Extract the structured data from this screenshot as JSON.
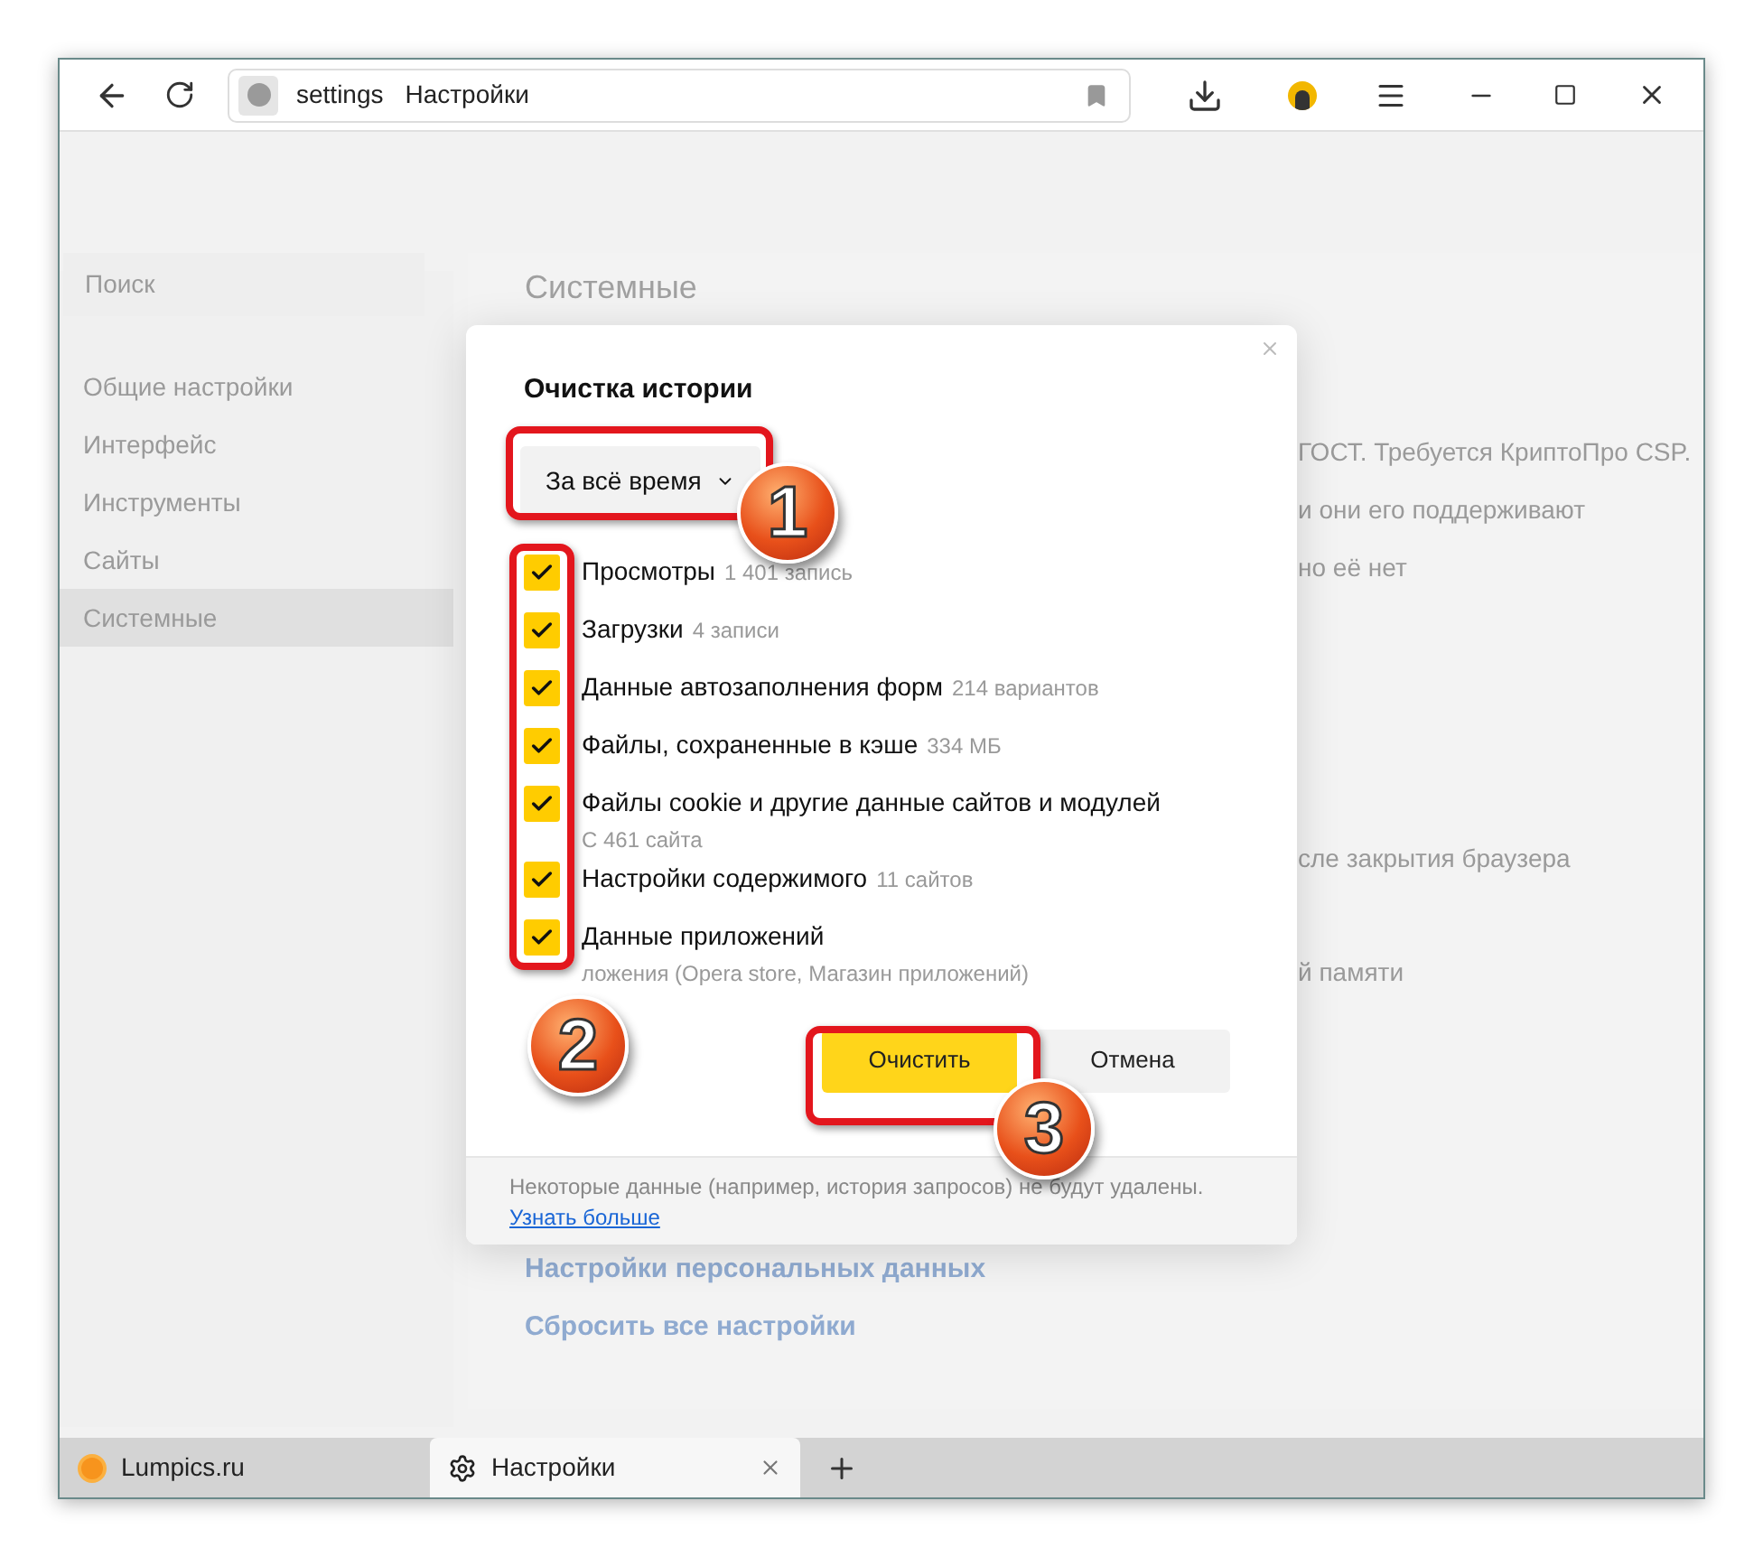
{
  "address_bar": {
    "site": "settings",
    "title": "Настройки"
  },
  "sidebar": {
    "search": {
      "placeholder": "Поиск"
    },
    "items": [
      {
        "label": "Общие настройки",
        "selected": false
      },
      {
        "label": "Интерфейс",
        "selected": false
      },
      {
        "label": "Инструменты",
        "selected": false
      },
      {
        "label": "Сайты",
        "selected": false
      },
      {
        "label": "Системные",
        "selected": true
      }
    ]
  },
  "main": {
    "heading": "Системные",
    "fragments_top": [
      "ГОСТ. Требуется КриптоПро CSP.",
      "и они его поддерживают",
      "но её нет"
    ],
    "fragments_bottom": [
      "сле закрытия браузера",
      "й памяти"
    ],
    "links": [
      "Настройки персональных данных",
      "Сбросить все настройки"
    ]
  },
  "dialog": {
    "title": "Очистка истории",
    "period": "За всё время",
    "options": [
      {
        "label": "Просмотры",
        "count": "1 401 запись",
        "checked": true
      },
      {
        "label": "Загрузки",
        "count": "4 записи",
        "checked": true
      },
      {
        "label": "Данные автозаполнения форм",
        "count": "214 вариантов",
        "checked": true
      },
      {
        "label": "Файлы, сохраненные в кэше",
        "count": "334 МБ",
        "checked": true
      },
      {
        "label": "Файлы cookie и другие данные сайтов и модулей",
        "detail": "С 461 сайта",
        "checked": true
      },
      {
        "label": "Настройки содержимого",
        "count": "11 сайтов",
        "checked": true
      },
      {
        "label": "Данные приложений",
        "detail": "ложения (Opera store, Магазин приложений)",
        "checked": true
      }
    ],
    "buttons": [
      {
        "label": "Очистить",
        "kind": "primary"
      },
      {
        "label": "Отмена",
        "kind": "secondary"
      }
    ],
    "note": "Некоторые данные (например, история запросов) не будут удалены.",
    "link": "Узнать больше"
  },
  "annotations": [
    "1",
    "2",
    "3"
  ],
  "tabs": [
    {
      "label": "Lumpics.ru",
      "selected": false
    },
    {
      "label": "Настройки",
      "selected": true
    }
  ]
}
